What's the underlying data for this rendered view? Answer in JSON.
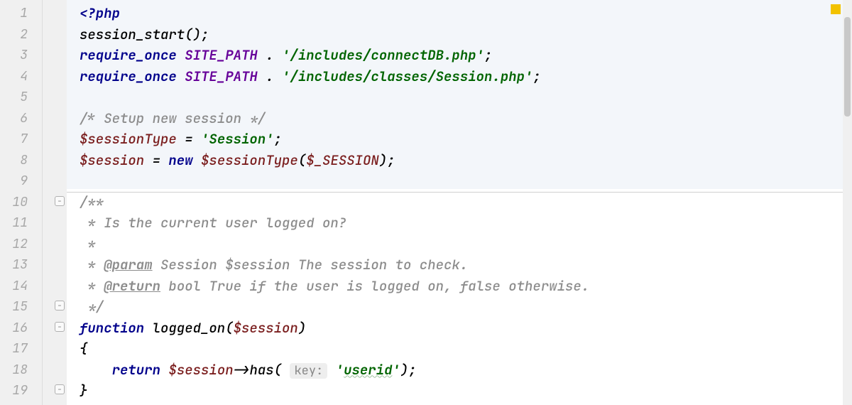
{
  "colors": {
    "keyword": "#00008b",
    "comment": "#8c8c8c",
    "string": "#006400",
    "constant": "#660099",
    "variable": "#7a1d1d",
    "gutter_bg": "#f0f0f0",
    "highlight_bg": "#f3f6fa"
  },
  "line_numbers": [
    "1",
    "2",
    "3",
    "4",
    "5",
    "6",
    "7",
    "8",
    "9",
    "10",
    "11",
    "12",
    "13",
    "14",
    "15",
    "16",
    "17",
    "18",
    "19"
  ],
  "tokens": {
    "l1": {
      "php_open": "<?php"
    },
    "l2": {
      "fn": "session_start",
      "paren": "();"
    },
    "l3": {
      "kw": "require_once",
      "sp": " ",
      "const": "SITE_PATH",
      "dot": " . ",
      "str": "'/includes/connectDB.php'",
      "semi": ";"
    },
    "l4": {
      "kw": "require_once",
      "sp": " ",
      "const": "SITE_PATH",
      "dot": " . ",
      "str": "'/includes/classes/Session.php'",
      "semi": ";"
    },
    "l6": {
      "cm": "/* Setup new session */"
    },
    "l7": {
      "var": "$sessionType",
      "eq": " = ",
      "str": "'Session'",
      "semi": ";"
    },
    "l8": {
      "var1": "$session",
      "eq": " = ",
      "kw": "new",
      "sp": " ",
      "var2": "$sessionType",
      "open": "(",
      "var3": "$_SESSION",
      "close": ");"
    },
    "l10": {
      "cm": "/**"
    },
    "l11": {
      "cm": " * Is the current user logged on?"
    },
    "l12": {
      "cm": " *"
    },
    "l13": {
      "pre": " * ",
      "tag": "@param",
      "rest": " Session $session The session to check."
    },
    "l14": {
      "pre": " * ",
      "tag": "@return",
      "rest": " bool True if the user is logged on, false otherwise."
    },
    "l15": {
      "cm": " */"
    },
    "l16": {
      "kw": "function",
      "sp": " ",
      "name": "logged_on",
      "open": "(",
      "var": "$session",
      "close": ")"
    },
    "l17": {
      "brace": "{"
    },
    "l18": {
      "indent": "    ",
      "kw": "return",
      "sp": " ",
      "var": "$session",
      "arrow": "->",
      "method": "has",
      "open": "( ",
      "hint": "key:",
      "sp2": " ",
      "strq": "'",
      "stru": "userid",
      "strq2": "'",
      "close": ");"
    },
    "l19": {
      "brace": "}"
    }
  }
}
